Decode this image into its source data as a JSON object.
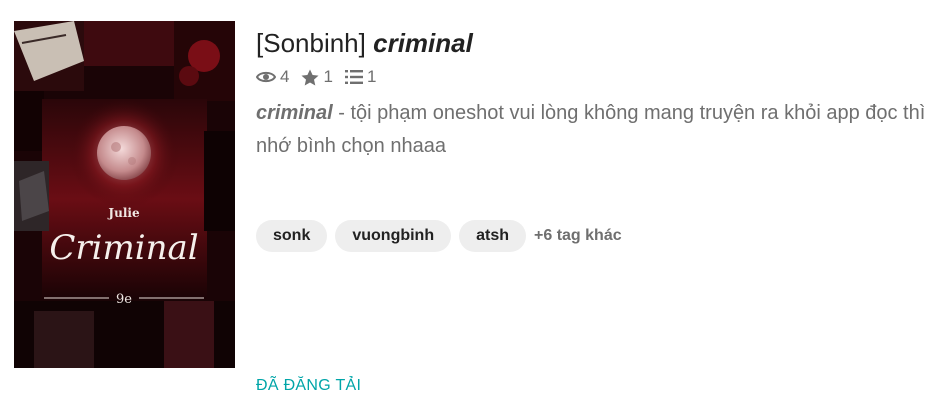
{
  "story": {
    "title_prefix": "[Sonbinh]",
    "title_emph": "criminal",
    "stats": {
      "reads": "4",
      "votes": "1",
      "parts": "1"
    },
    "description_emph": "criminal",
    "description_rest": " - tội phạm oneshot vui lòng không mang truyện ra khỏi app đọc thì nhớ bình chọn nhaaa",
    "tags": [
      "sonk",
      "vuongbinh",
      "atsh"
    ],
    "more_tags": "+6 tag khác",
    "status": "ĐÃ ĐĂNG TẢI"
  },
  "cover": {
    "author": "Julie",
    "title": "Criminal",
    "number": "9e"
  },
  "icons": {
    "reads": "eye-icon",
    "votes": "star-icon",
    "parts": "list-icon"
  },
  "colors": {
    "accent": "#00a5a8",
    "tag_bg": "#eeeeee",
    "muted": "#6f6f6f"
  }
}
